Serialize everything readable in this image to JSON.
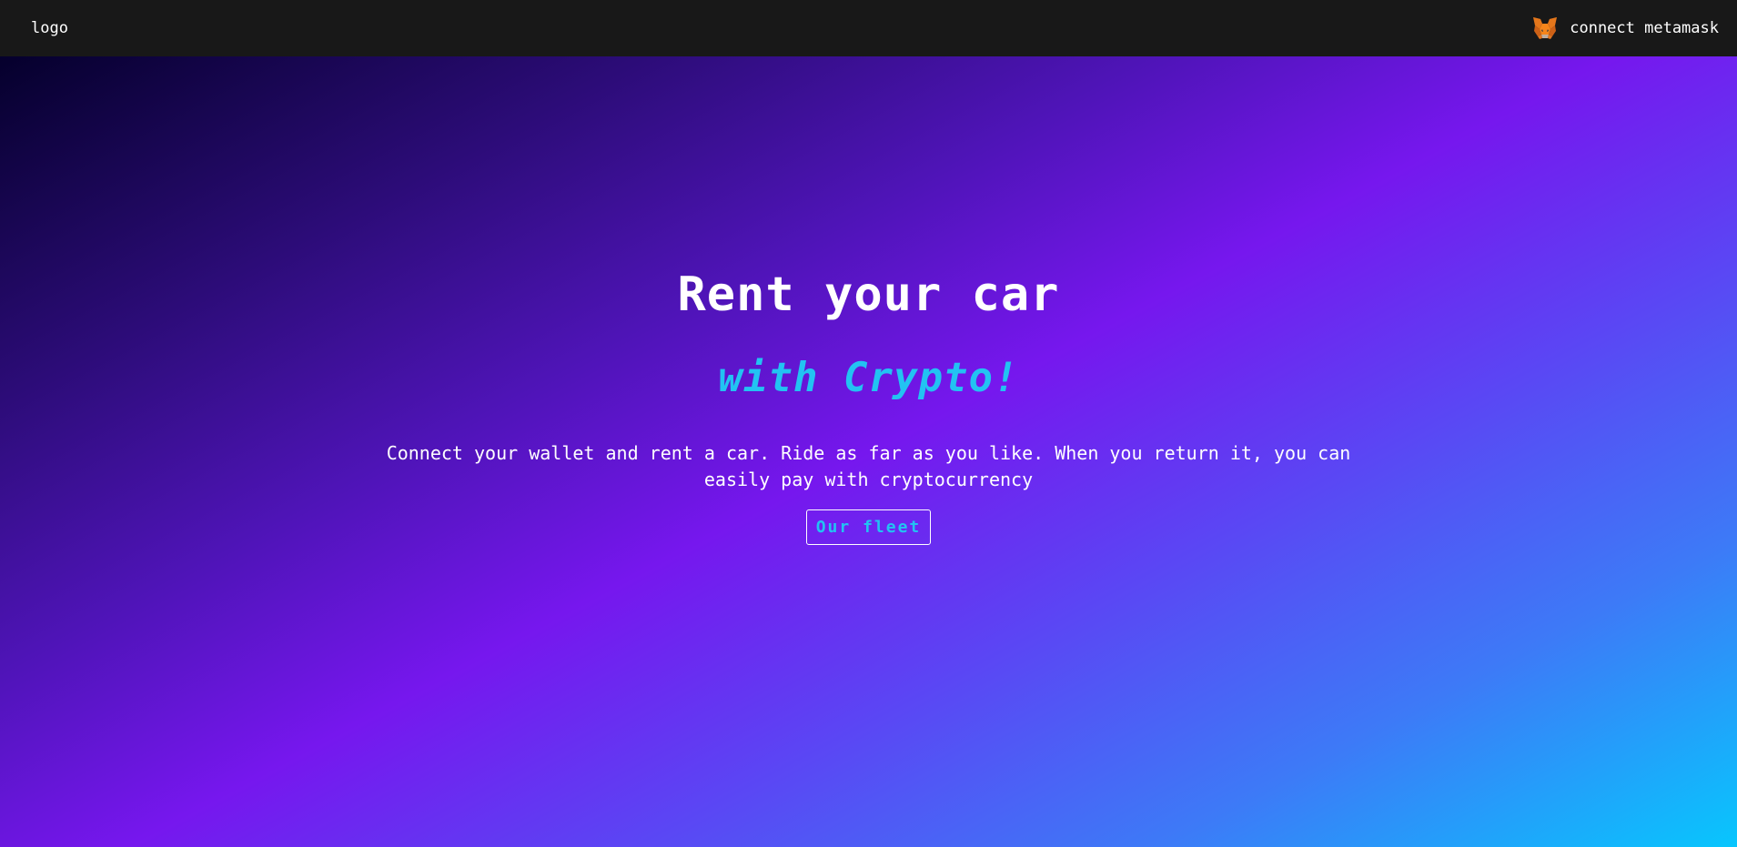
{
  "navbar": {
    "logo_text": "logo",
    "connect_label": "connect metamask",
    "connect_icon": "metamask-fox-icon"
  },
  "hero": {
    "title": "Rent your car",
    "subtitle": "with Crypto!",
    "description": "Connect your wallet and rent a car. Ride as far as you like. When you return it, you can easily pay with cryptocurrency",
    "cta_label": "Our fleet"
  },
  "colors": {
    "navbar_bg": "#181818",
    "accent": "#22c3f2",
    "gradient_start": "#05002c",
    "gradient_mid": "#7617ee",
    "gradient_end": "#08c6fd"
  }
}
